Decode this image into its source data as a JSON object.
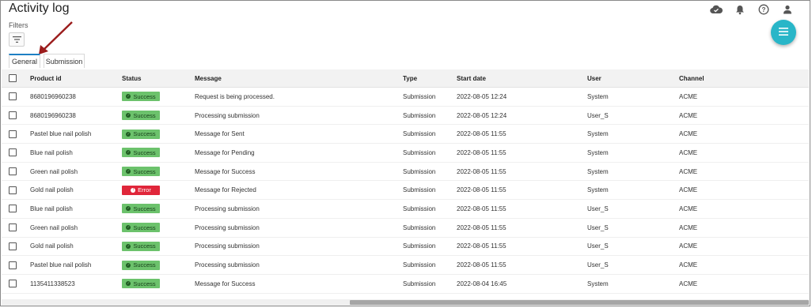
{
  "header": {
    "title": "Activity log",
    "icons": [
      "cloud-check-icon",
      "bell-icon",
      "help-icon",
      "account-icon"
    ]
  },
  "filters": {
    "label": "Filters",
    "icon": "filter-icon"
  },
  "fab": {
    "icon": "menu-icon",
    "color": "#29b6c8"
  },
  "tabs": [
    {
      "label": "General",
      "active": true
    },
    {
      "label": "Submission",
      "active": false
    }
  ],
  "table": {
    "columns": [
      "Product id",
      "Status",
      "Message",
      "Type",
      "Start date",
      "User",
      "Channel"
    ],
    "rows": [
      {
        "product_id": "8680196960238",
        "status": "Success",
        "message": "Request is being processed.",
        "type": "Submission",
        "start_date": "2022-08-05 12:24",
        "user": "System",
        "channel": "ACME"
      },
      {
        "product_id": "8680196960238",
        "status": "Success",
        "message": "Processing submission",
        "type": "Submission",
        "start_date": "2022-08-05 12:24",
        "user": "User_S",
        "channel": "ACME"
      },
      {
        "product_id": "Pastel blue nail polish",
        "status": "Success",
        "message": "Message for Sent",
        "type": "Submission",
        "start_date": "2022-08-05 11:55",
        "user": "System",
        "channel": "ACME"
      },
      {
        "product_id": "Blue nail polish",
        "status": "Success",
        "message": "Message for Pending",
        "type": "Submission",
        "start_date": "2022-08-05 11:55",
        "user": "System",
        "channel": "ACME"
      },
      {
        "product_id": "Green nail polish",
        "status": "Success",
        "message": "Message for Success",
        "type": "Submission",
        "start_date": "2022-08-05 11:55",
        "user": "System",
        "channel": "ACME"
      },
      {
        "product_id": "Gold nail polish",
        "status": "Error",
        "message": "Message for Rejected",
        "type": "Submission",
        "start_date": "2022-08-05 11:55",
        "user": "System",
        "channel": "ACME"
      },
      {
        "product_id": "Blue nail polish",
        "status": "Success",
        "message": "Processing submission",
        "type": "Submission",
        "start_date": "2022-08-05 11:55",
        "user": "User_S",
        "channel": "ACME"
      },
      {
        "product_id": "Green nail polish",
        "status": "Success",
        "message": "Processing submission",
        "type": "Submission",
        "start_date": "2022-08-05 11:55",
        "user": "User_S",
        "channel": "ACME"
      },
      {
        "product_id": "Gold nail polish",
        "status": "Success",
        "message": "Processing submission",
        "type": "Submission",
        "start_date": "2022-08-05 11:55",
        "user": "User_S",
        "channel": "ACME"
      },
      {
        "product_id": "Pastel blue nail polish",
        "status": "Success",
        "message": "Processing submission",
        "type": "Submission",
        "start_date": "2022-08-05 11:55",
        "user": "User_S",
        "channel": "ACME"
      },
      {
        "product_id": "1135411338523",
        "status": "Success",
        "message": "Message for Success",
        "type": "Submission",
        "start_date": "2022-08-04 16:45",
        "user": "System",
        "channel": "ACME"
      }
    ]
  },
  "colors": {
    "success": "#6cc26c",
    "error": "#e0263a",
    "accent": "#1e7fc4",
    "annotation_arrow": "#9b1c1c"
  }
}
